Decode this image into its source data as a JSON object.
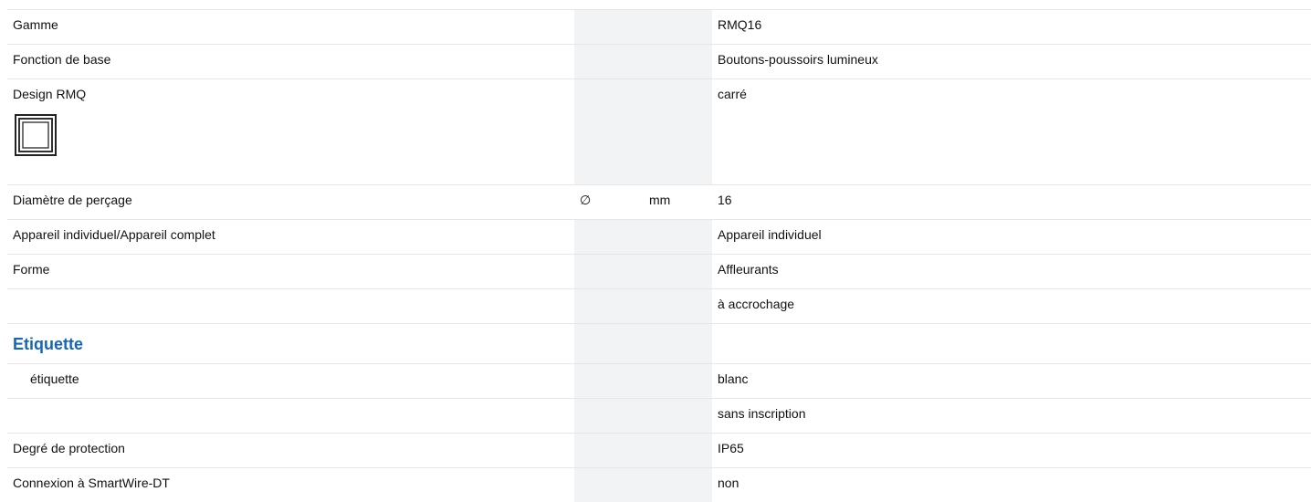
{
  "rows": [
    {
      "label": "Gamme",
      "symbol": "",
      "unit": "",
      "value": "RMQ16"
    },
    {
      "label": "Fonction de base",
      "symbol": "",
      "unit": "",
      "value": "Boutons-poussoirs lumineux"
    },
    {
      "label": "Design RMQ",
      "symbol": "",
      "unit": "",
      "value": "carré",
      "icon": "square-design-icon"
    },
    {
      "label": "Diamètre de perçage",
      "symbol": "∅",
      "unit": "mm",
      "value": "16"
    },
    {
      "label": "Appareil individuel/Appareil complet",
      "symbol": "",
      "unit": "",
      "value": "Appareil individuel"
    },
    {
      "label": "Forme",
      "symbol": "",
      "unit": "",
      "value": "Affleurants"
    },
    {
      "label": "",
      "symbol": "",
      "unit": "",
      "value": "à accrochage"
    },
    {
      "section": "Etiquette"
    },
    {
      "label": "étiquette",
      "symbol": "",
      "unit": "",
      "value": "blanc"
    },
    {
      "label": "",
      "symbol": "",
      "unit": "",
      "value": "sans inscription"
    },
    {
      "label": "Degré de protection",
      "symbol": "",
      "unit": "",
      "value": "IP65"
    },
    {
      "label": "Connexion à SmartWire-DT",
      "symbol": "",
      "unit": "",
      "value": "non"
    }
  ],
  "colors": {
    "section_title": "#1566b8",
    "shaded_column": "#f2f3f5",
    "divider": "#e6e6e6"
  }
}
